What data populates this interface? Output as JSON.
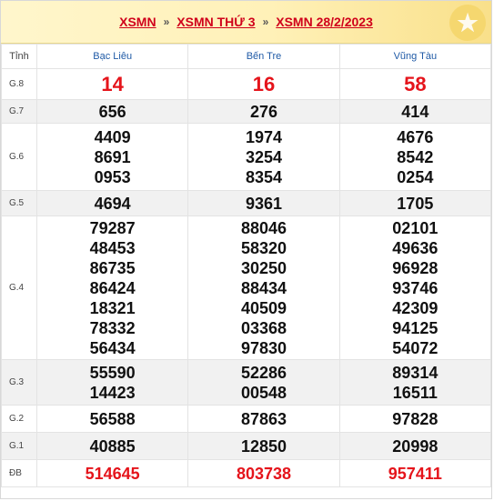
{
  "breadcrumbs": [
    "XSMN",
    "XSMN THỨ 3",
    "XSMN 28/2/2023"
  ],
  "breadcrumb_separator": "»",
  "table": {
    "header": [
      "Tỉnh",
      "Bạc Liêu",
      "Bến Tre",
      "Vũng Tàu"
    ],
    "rows": [
      {
        "prize": "G.8",
        "values": [
          [
            "14"
          ],
          [
            "16"
          ],
          [
            "58"
          ]
        ]
      },
      {
        "prize": "G.7",
        "values": [
          [
            "656"
          ],
          [
            "276"
          ],
          [
            "414"
          ]
        ]
      },
      {
        "prize": "G.6",
        "values": [
          [
            "4409",
            "8691",
            "0953"
          ],
          [
            "1974",
            "3254",
            "8354"
          ],
          [
            "4676",
            "8542",
            "0254"
          ]
        ]
      },
      {
        "prize": "G.5",
        "values": [
          [
            "4694"
          ],
          [
            "9361"
          ],
          [
            "1705"
          ]
        ]
      },
      {
        "prize": "G.4",
        "values": [
          [
            "79287",
            "48453",
            "86735",
            "86424",
            "18321",
            "78332",
            "56434"
          ],
          [
            "88046",
            "58320",
            "30250",
            "88434",
            "40509",
            "03368",
            "97830"
          ],
          [
            "02101",
            "49636",
            "96928",
            "93746",
            "42309",
            "94125",
            "54072"
          ]
        ]
      },
      {
        "prize": "G.3",
        "values": [
          [
            "55590",
            "14423"
          ],
          [
            "52286",
            "00548"
          ],
          [
            "89314",
            "16511"
          ]
        ]
      },
      {
        "prize": "G.2",
        "values": [
          [
            "56588"
          ],
          [
            "87863"
          ],
          [
            "97828"
          ]
        ]
      },
      {
        "prize": "G.1",
        "values": [
          [
            "40885"
          ],
          [
            "12850"
          ],
          [
            "20998"
          ]
        ]
      },
      {
        "prize": "ĐB",
        "values": [
          [
            "514645"
          ],
          [
            "803738"
          ],
          [
            "957411"
          ]
        ]
      }
    ]
  },
  "colors": {
    "accent_red": "#e5141b",
    "link_red": "#d0021b",
    "header_blue": "#1f5aa6"
  }
}
